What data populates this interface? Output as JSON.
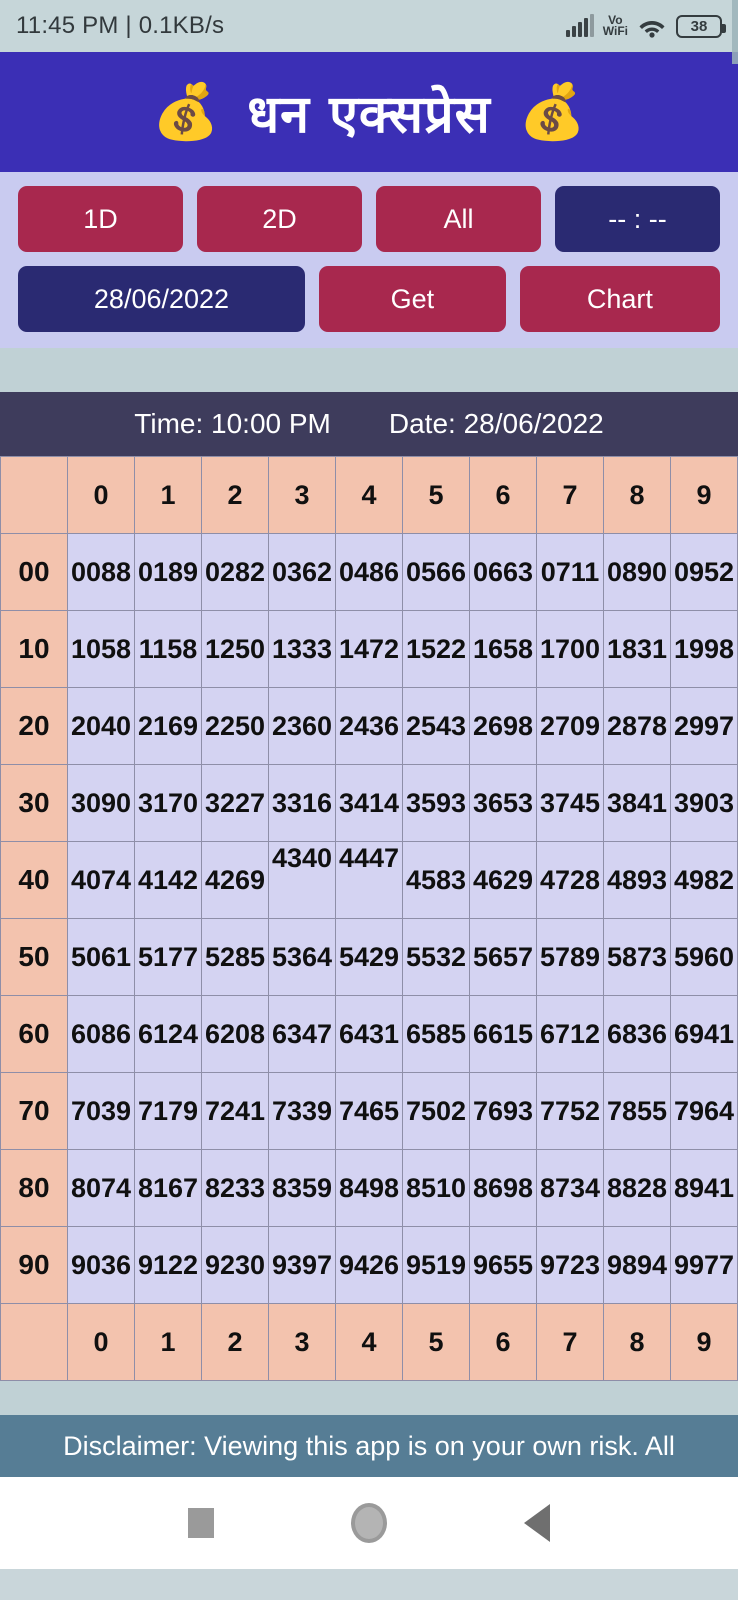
{
  "statusbar": {
    "time_and_net": "11:45 PM | 0.1KB/s",
    "signal_icon": "signal-bars-icon",
    "vo_label": "Vo",
    "wifi_label": "WiFi",
    "wifi_icon": "wifi-icon",
    "battery_level": "38"
  },
  "header": {
    "title": "धन एक्सप्रेस",
    "left_emoji": "💰",
    "right_emoji": "💰"
  },
  "controls": {
    "btn_1d": "1D",
    "btn_2d": "2D",
    "btn_all": "All",
    "btn_time": "-- : --",
    "btn_date": "28/06/2022",
    "btn_get": "Get",
    "btn_chart": "Chart"
  },
  "result_bar": {
    "time_label": "Time: 10:00 PM",
    "date_label": "Date: 28/06/2022"
  },
  "chart_data": {
    "type": "table",
    "title": "Time: 10:00 PM  Date: 28/06/2022",
    "column_headers": [
      "",
      "0",
      "1",
      "2",
      "3",
      "4",
      "5",
      "6",
      "7",
      "8",
      "9"
    ],
    "footer_headers": [
      "",
      "0",
      "1",
      "2",
      "3",
      "4",
      "5",
      "6",
      "7",
      "8",
      "9"
    ],
    "row_headers": [
      "00",
      "10",
      "20",
      "30",
      "40",
      "50",
      "60",
      "70",
      "80",
      "90"
    ],
    "rows": [
      {
        "head": "00",
        "values": [
          "0088",
          "0189",
          "0282",
          "0362",
          "0486",
          "0566",
          "0663",
          "0711",
          "0890",
          "0952"
        ]
      },
      {
        "head": "10",
        "values": [
          "1058",
          "1158",
          "1250",
          "1333",
          "1472",
          "1522",
          "1658",
          "1700",
          "1831",
          "1998"
        ]
      },
      {
        "head": "20",
        "values": [
          "2040",
          "2169",
          "2250",
          "2360",
          "2436",
          "2543",
          "2698",
          "2709",
          "2878",
          "2997"
        ]
      },
      {
        "head": "30",
        "values": [
          "3090",
          "3170",
          "3227",
          "3316",
          "3414",
          "3593",
          "3653",
          "3745",
          "3841",
          "3903"
        ]
      },
      {
        "head": "40",
        "values": [
          "4074",
          "4142",
          "4269",
          "4340",
          "4447",
          "4583",
          "4629",
          "4728",
          "4893",
          "4982"
        ]
      },
      {
        "head": "50",
        "values": [
          "5061",
          "5177",
          "5285",
          "5364",
          "5429",
          "5532",
          "5657",
          "5789",
          "5873",
          "5960"
        ]
      },
      {
        "head": "60",
        "values": [
          "6086",
          "6124",
          "6208",
          "6347",
          "6431",
          "6585",
          "6615",
          "6712",
          "6836",
          "6941"
        ]
      },
      {
        "head": "70",
        "values": [
          "7039",
          "7179",
          "7241",
          "7339",
          "7465",
          "7502",
          "7693",
          "7752",
          "7855",
          "7964"
        ]
      },
      {
        "head": "80",
        "values": [
          "8074",
          "8167",
          "8233",
          "8359",
          "8498",
          "8510",
          "8698",
          "8734",
          "8828",
          "8941"
        ]
      },
      {
        "head": "90",
        "values": [
          "9036",
          "9122",
          "9230",
          "9397",
          "9426",
          "9519",
          "9655",
          "9723",
          "9894",
          "9977"
        ]
      }
    ],
    "header_bg": "#f3c3ae",
    "cell_bg": "#d4d3f2",
    "grid_color": "#8e8ea8"
  },
  "footer": {
    "disclaimer": "Disclaimer: Viewing this app is on your own risk. All"
  },
  "navbar": {
    "recents_icon": "square-recents-icon",
    "home_icon": "circle-home-icon",
    "back_icon": "triangle-back-icon"
  },
  "colors": {
    "header_bg": "#3b2fb5",
    "accent_red": "#a8284e",
    "accent_navy": "#2a2a72",
    "controls_bg": "#c9cbf0",
    "resultbar_bg": "#3e3c5c",
    "disclaimer_bg": "#567d95"
  }
}
